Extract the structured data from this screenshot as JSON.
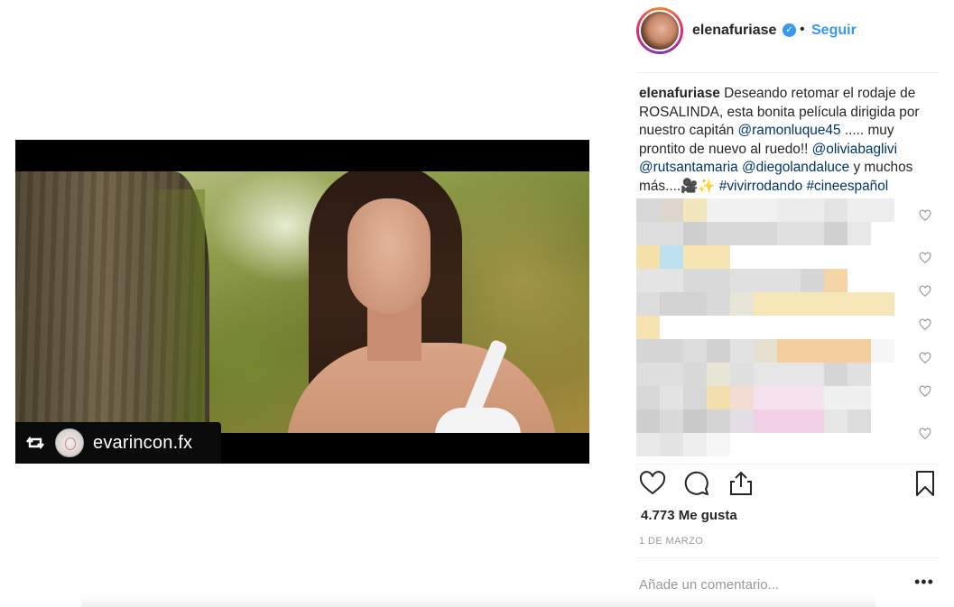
{
  "post": {
    "username": "elenafuriase",
    "verified_icon": "verified-badge-icon",
    "separator": "•",
    "follow_label": "Seguir",
    "caption": {
      "username": "elenafuriase",
      "text_1": " Deseando retomar el rodaje de ROSALINDA, esta bonita película dirigida por nuestro capitán ",
      "mention_1": "@ramonluque45",
      "text_2": " ..... muy prontito de nuevo al ruedo!! ",
      "mention_2": "@oliviabaglivi",
      "text_3": " ",
      "mention_3": "@rutsantamaria",
      "text_4": " ",
      "mention_4": "@diegolandaluce",
      "text_5": " y muchos más....🎥✨ ",
      "hashtag_1": "#vivirrodando",
      "text_6": " ",
      "hashtag_2": "#cineespañol"
    },
    "likes_text": "4.773 Me gusta",
    "date": "1 DE MARZO",
    "comment_placeholder": "Añade un comentario...",
    "more_label": "•••"
  },
  "media": {
    "repost_icon": "repost-icon",
    "repost_account": "evarincon.fx"
  },
  "icons": {
    "like": "heart-icon",
    "comment": "comment-icon",
    "share": "share-icon",
    "save": "bookmark-icon"
  },
  "colors": {
    "accent_blue": "#3897f0",
    "link_blue": "#003569",
    "text": "#262626",
    "muted": "#999999",
    "divider": "#efefef"
  }
}
